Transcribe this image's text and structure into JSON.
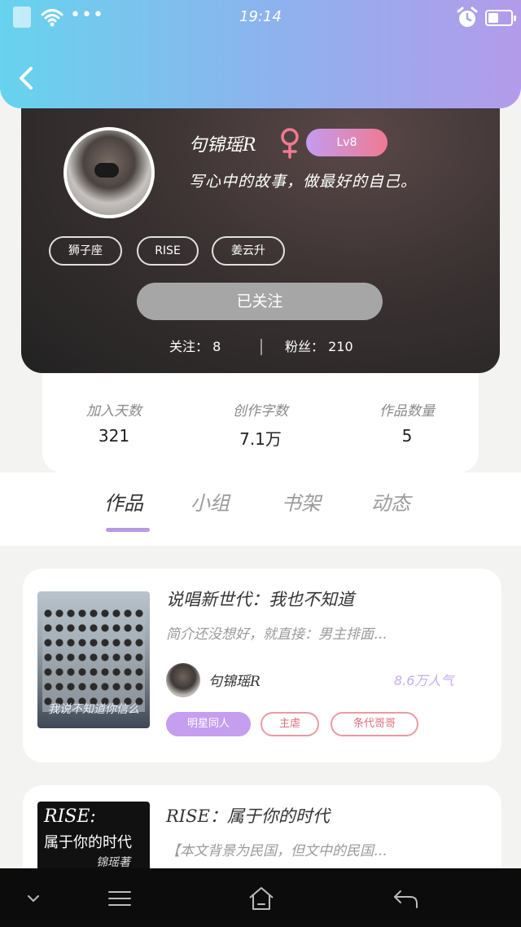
{
  "status_bar": {
    "time": "19:14",
    "dots": "•••",
    "icons": [
      "wifi-icon",
      "alarm-icon",
      "battery-icon"
    ]
  },
  "nav": {
    "back_icon": "chevron-left-icon"
  },
  "profile": {
    "username": "句锦瑶R",
    "gender_icon": "female-icon",
    "level": "Lv8",
    "signature": "写心中的故事，做最好的自己。",
    "tags": [
      "狮子座",
      "RISE",
      "姜云升"
    ],
    "follow_button": "已关注",
    "following_label": "关注：",
    "following_count": "8",
    "fans_label": "粉丝：",
    "fans_count": "210"
  },
  "creation_stats": [
    {
      "label": "加入天数",
      "value": "321"
    },
    {
      "label": "创作字数",
      "value": "7.1万"
    },
    {
      "label": "作品数量",
      "value": "5"
    }
  ],
  "tabs": [
    {
      "label": "作品",
      "active": true
    },
    {
      "label": "小组",
      "active": false
    },
    {
      "label": "书架",
      "active": false
    },
    {
      "label": "动态",
      "active": false
    }
  ],
  "works": [
    {
      "title": "说唱新世代：我也不知道",
      "description": "简介还没想好，就直接：男主排面...",
      "author": "句锦瑶R",
      "popularity": "8.6万人气",
      "cover_text": "我说不知道你信么",
      "tags": [
        "明星同人",
        "主虐",
        "条代哥哥"
      ]
    },
    {
      "title": "RISE：属于你的时代",
      "description": "【本文背景为民国，但文中的民国...",
      "cover_title": "RISE:",
      "cover_subtitle": "属于你的时代",
      "cover_author": "锦瑶著"
    }
  ],
  "bottom_nav": [
    "chevron-down-icon",
    "menu-icon",
    "home-icon",
    "back-arrow-icon"
  ],
  "colors": {
    "header_gradient_start": "#67d3ee",
    "header_gradient_end": "#b39bea",
    "accent_purple": "#b89ae6",
    "level_gradient_end": "#f07a92",
    "chip_outline": "#e99aa3"
  }
}
